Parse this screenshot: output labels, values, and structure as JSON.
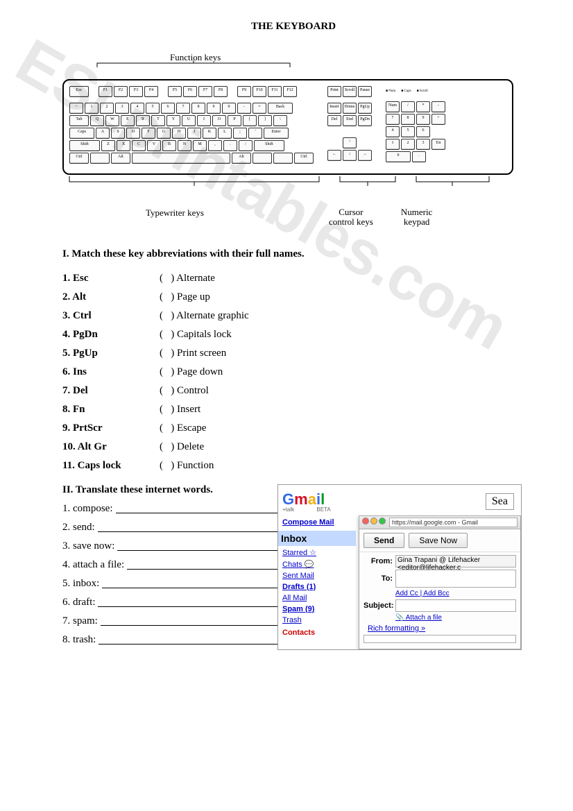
{
  "title": "THE KEYBOARD",
  "diagram": {
    "function_keys": "Function keys",
    "typewriter_keys": "Typewriter keys",
    "cursor_control": "Cursor\ncontrol keys",
    "numeric_keypad": "Numeric\nkeypad",
    "rows": {
      "fn": [
        "Esc",
        "F1",
        "F2",
        "F3",
        "F4",
        "F5",
        "F6",
        "F7",
        "F8",
        "F9",
        "F10",
        "F11",
        "F12"
      ],
      "block_top": [
        "Print",
        "Scroll",
        "Pause"
      ],
      "r1": [
        "~",
        "1",
        "2",
        "3",
        "4",
        "5",
        "6",
        "7",
        "8",
        "9",
        "0",
        "-",
        "=",
        "Back"
      ],
      "r2": [
        "Tab",
        "Q",
        "W",
        "E",
        "R",
        "T",
        "Y",
        "U",
        "I",
        "O",
        "P",
        "[",
        "]",
        "\\"
      ],
      "r3": [
        "Caps",
        "A",
        "S",
        "D",
        "F",
        "G",
        "H",
        "J",
        "K",
        "L",
        ";",
        "'",
        "Enter"
      ],
      "r4": [
        "Shift",
        "Z",
        "X",
        "C",
        "V",
        "B",
        "N",
        "M",
        ",",
        ".",
        "/",
        "Shift"
      ],
      "r5": [
        "Ctrl",
        "",
        "Alt",
        "",
        "Alt",
        "",
        "",
        "Ctrl"
      ],
      "nav1": [
        "Insert",
        "Home",
        "PgUp"
      ],
      "nav2": [
        "Del",
        "End",
        "PgDn"
      ],
      "arrows": [
        "↑",
        "←",
        "↓",
        "→"
      ],
      "leds": [
        "Num",
        "Caps",
        "Scroll"
      ],
      "np1": [
        "Num",
        "/",
        "*",
        "-"
      ],
      "np2": [
        "7",
        "8",
        "9",
        "+"
      ],
      "np3": [
        "4",
        "5",
        "6"
      ],
      "np4": [
        "1",
        "2",
        "3",
        "En"
      ],
      "np5": [
        "0",
        ".",
        ""
      ]
    }
  },
  "section1": {
    "header": "I. Match these key abbreviations with their full names.",
    "items": [
      {
        "n": "1.",
        "abbr": "Esc",
        "full": "Alternate"
      },
      {
        "n": "2.",
        "abbr": "Alt",
        "full": "Page up"
      },
      {
        "n": "3.",
        "abbr": "Ctrl",
        "full": "Alternate graphic"
      },
      {
        "n": "4.",
        "abbr": "PgDn",
        "full": "Capitals lock"
      },
      {
        "n": "5.",
        "abbr": "PgUp",
        "full": "Print screen"
      },
      {
        "n": "6.",
        "abbr": "Ins",
        "full": "Page down"
      },
      {
        "n": "7.",
        "abbr": "Del",
        "full": "Control"
      },
      {
        "n": "8.",
        "abbr": "Fn",
        "full": "Insert"
      },
      {
        "n": "9.",
        "abbr": "PrtScr",
        "full": "Escape"
      },
      {
        "n": "10.",
        "abbr": "Alt Gr",
        "full": "Delete"
      },
      {
        "n": "11.",
        "abbr": "Caps lock",
        "full": "Function"
      }
    ]
  },
  "section2": {
    "header": "II. Translate these internet words.",
    "items": [
      {
        "n": "1.",
        "w": "compose:"
      },
      {
        "n": "2.",
        "w": "send:"
      },
      {
        "n": "3.",
        "w": "save now:"
      },
      {
        "n": "4.",
        "w": "attach a file:"
      },
      {
        "n": "5.",
        "w": "inbox:"
      },
      {
        "n": "6.",
        "w": "draft:"
      },
      {
        "n": "7.",
        "w": "spam:"
      },
      {
        "n": "8.",
        "w": "trash:"
      }
    ]
  },
  "gmail": {
    "logo_g": "G",
    "logo_m": "m",
    "logo_ail": "ail",
    "beta": "BETA",
    "talk": "+talk",
    "search": "Sea",
    "compose": "Compose Mail",
    "inbox": "Inbox",
    "nav": [
      "Starred ☆",
      "Chats 💬",
      "Sent Mail",
      "Drafts (1)",
      "All Mail",
      "Spam (9)",
      "Trash"
    ],
    "contacts": "Contacts",
    "url": "https://mail.google.com - Gmail",
    "btn_send": "Send",
    "btn_save": "Save Now",
    "from": "From:",
    "from_val": "Gina Trapani @ Lifehacker <editor@lifehacker.c",
    "to": "To:",
    "addcc": "Add Cc",
    "addbcc": "Add Bcc",
    "subject": "Subject:",
    "attach": "Attach a file",
    "rich": "Rich formatting »"
  },
  "watermark": "ESLprintables.com"
}
